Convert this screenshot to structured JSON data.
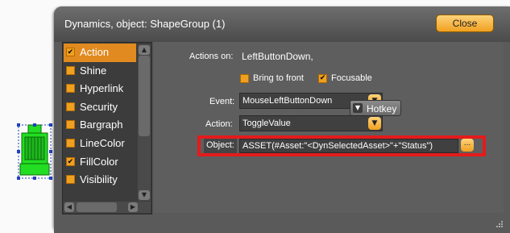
{
  "dialog": {
    "title": "Dynamics, object: ShapeGroup (1)",
    "close_label": "Close"
  },
  "sidebar": {
    "items": [
      {
        "label": "Action",
        "checked": true,
        "selected": true
      },
      {
        "label": "Shine",
        "checked": false,
        "selected": false
      },
      {
        "label": "Hyperlink",
        "checked": false,
        "selected": false
      },
      {
        "label": "Security",
        "checked": false,
        "selected": false
      },
      {
        "label": "Bargraph",
        "checked": false,
        "selected": false
      },
      {
        "label": "LineColor",
        "checked": false,
        "selected": false
      },
      {
        "label": "FillColor",
        "checked": true,
        "selected": false
      },
      {
        "label": "Visibility",
        "checked": false,
        "selected": false
      }
    ]
  },
  "action_panel": {
    "actions_on_label": "Actions on:",
    "actions_on_value": "LeftButtonDown,",
    "bring_to_front_label": "Bring to front",
    "focusable_label": "Focusable",
    "event_label": "Event:",
    "event_value": "MouseLeftButtonDown",
    "action_label": "Action:",
    "action_value": "ToggleValue",
    "hotkey_label": "Hotkey",
    "object_label": "Object:",
    "object_value": "ASSET(#Asset:\"<DynSelectedAsset>\"+\"Status\")",
    "browse_label": "..."
  },
  "colors": {
    "accent": "#f0a020",
    "highlight": "#e41b1b",
    "shape_fill": "#22dd22"
  }
}
